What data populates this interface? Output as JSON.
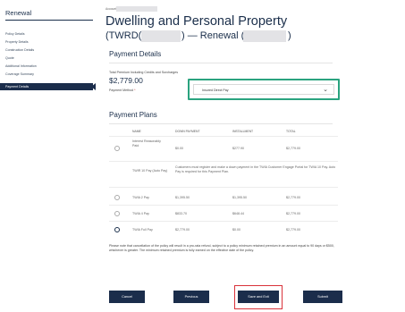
{
  "sidebar": {
    "title": "Renewal",
    "items": [
      {
        "label": "Policy Details"
      },
      {
        "label": "Property Details"
      },
      {
        "label": "Construction Details"
      },
      {
        "label": "Quote"
      },
      {
        "label": "Additional Information"
      },
      {
        "label": "Coverage Summary"
      },
      {
        "label": "Payment Details"
      }
    ]
  },
  "header": {
    "account_label": "Account",
    "title": "Dwelling and Personal Property",
    "subtitle_prefix": "(TWRD(",
    "subtitle_mid": ") — Renewal (",
    "subtitle_end": ")"
  },
  "payment_details": {
    "heading": "Payment Details",
    "total_label": "Total Premium Including Credits and Surcharges",
    "total_amount": "$2,779.00",
    "method_label": "Payment Method",
    "method_required": "*",
    "method_value": "Insured Direct Pay"
  },
  "payment_plans": {
    "heading": "Payment Plans",
    "columns": [
      "NAME",
      "DOWN PAYMENT",
      "INSTALLMENT",
      "TOTAL"
    ],
    "rows": [
      {
        "name": "Interest Reasonably Paid",
        "down": "$0.00",
        "installment": "$277.90",
        "total": "$2,779.00",
        "selected": false
      },
      {
        "name": "TWIR 10 Pay (Auto Pay)",
        "note": "Customers must register and make a down payment in the TWIA Customer Engage Portal for TWIA 10 Pay. Auto Pay is required for this Payment Plan.",
        "selected": false
      },
      {
        "name": "TWIA 2 Pay",
        "down": "$1,395.50",
        "installment": "$1,395.50",
        "total": "$2,779.00",
        "selected": false
      },
      {
        "name": "TWIA 4 Pay",
        "down": "$833.70",
        "installment": "$648.44",
        "total": "$2,779.00",
        "selected": false
      },
      {
        "name": "TWIA Full Pay",
        "down": "$2,779.00",
        "installment": "$0.00",
        "total": "$2,779.00",
        "selected": true
      }
    ]
  },
  "notice": "Please note that cancellation of the policy will result in a pro-rata refund, subject to a policy minimum retained premium in an amount equal to 90 days or $500, whichever is greater. The minimum retained premium is fully earned on the effective date of the policy.",
  "buttons": {
    "cancel": "Cancel",
    "previous": "Previous",
    "save_exit": "Save and Exit",
    "submit": "Submit"
  }
}
